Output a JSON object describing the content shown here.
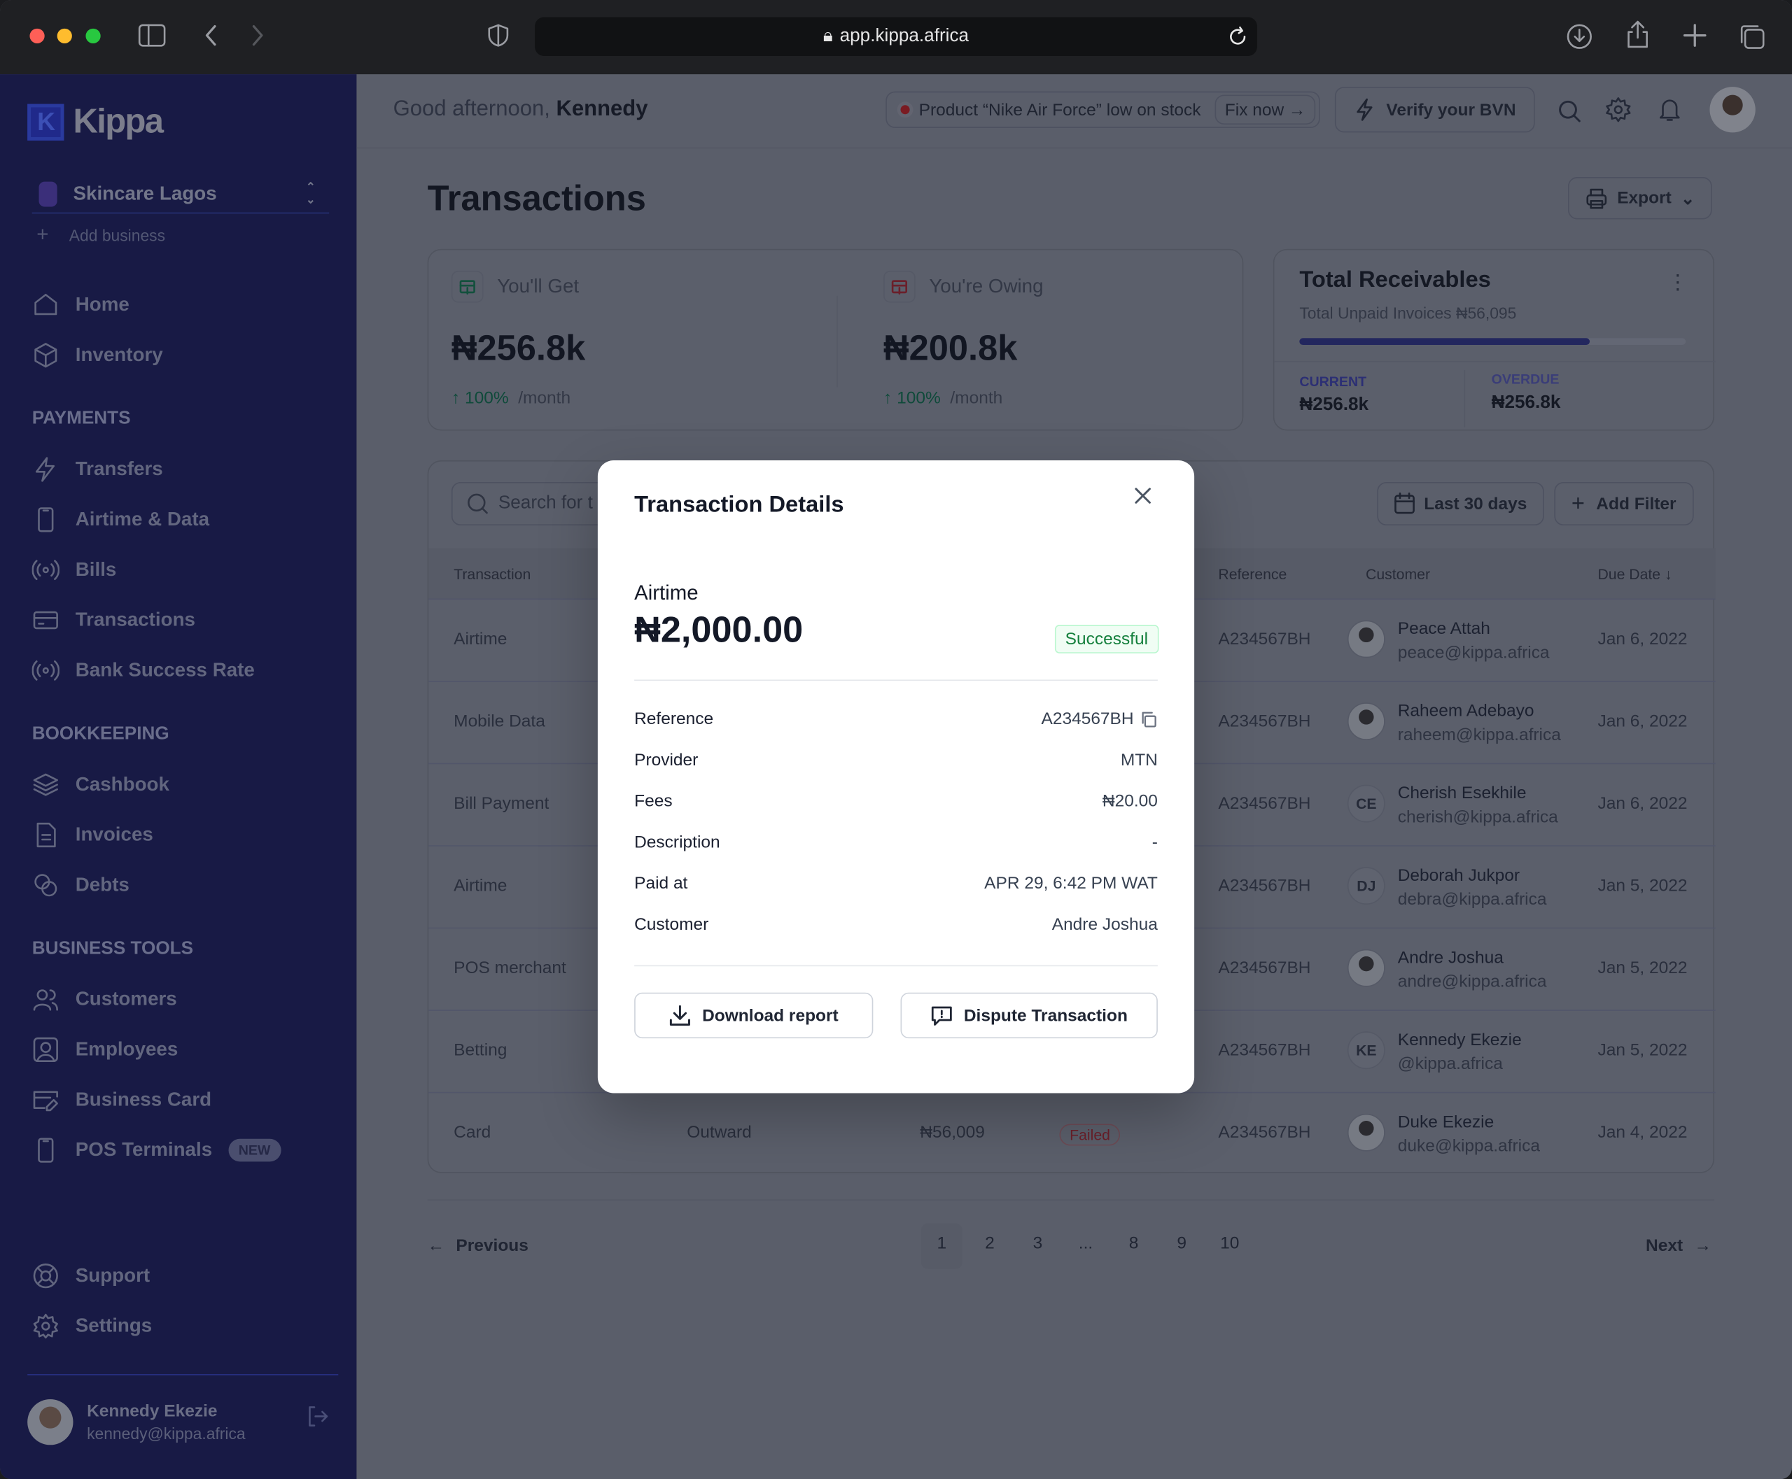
{
  "browser": {
    "url": "app.kippa.africa"
  },
  "sidebar": {
    "logo": "Kippa",
    "business": "Skincare Lagos",
    "add_business": "Add business",
    "top": [
      {
        "label": "Home",
        "icon": "home"
      },
      {
        "label": "Inventory",
        "icon": "box"
      }
    ],
    "sections": [
      {
        "title": "PAYMENTS",
        "items": [
          {
            "label": "Transfers",
            "icon": "bolt"
          },
          {
            "label": "Airtime & Data",
            "icon": "phone"
          },
          {
            "label": "Bills",
            "icon": "broadcast"
          },
          {
            "label": "Transactions",
            "icon": "card"
          },
          {
            "label": "Bank Success Rate",
            "icon": "broadcast"
          }
        ]
      },
      {
        "title": "BOOKKEEPING",
        "items": [
          {
            "label": "Cashbook",
            "icon": "layers"
          },
          {
            "label": "Invoices",
            "icon": "doc"
          },
          {
            "label": "Debts",
            "icon": "coins"
          }
        ]
      },
      {
        "title": "BUSINESS TOOLS",
        "items": [
          {
            "label": "Customers",
            "icon": "users"
          },
          {
            "label": "Employees",
            "icon": "user-square"
          },
          {
            "label": "Business Card",
            "icon": "card-edit"
          },
          {
            "label": "POS Terminals",
            "icon": "phone",
            "badge": "NEW"
          }
        ]
      }
    ],
    "bottom": [
      {
        "label": "Support",
        "icon": "lifebuoy"
      },
      {
        "label": "Settings",
        "icon": "gear"
      }
    ],
    "user": {
      "name": "Kennedy Ekezie",
      "email": "kennedy@kippa.africa"
    }
  },
  "header": {
    "greeting": "Good afternoon,",
    "name": "Kennedy",
    "alert": "Product “Nike Air Force” low on stock",
    "fix": "Fix now",
    "verify": "Verify your BVN"
  },
  "page": {
    "title": "Transactions",
    "export": "Export"
  },
  "stats": {
    "get": {
      "label": "You'll Get",
      "value": "₦256.8k",
      "change": "100%",
      "period": "/month"
    },
    "owing": {
      "label": "You're Owing",
      "value": "₦200.8k",
      "change": "100%",
      "period": "/month"
    },
    "receivables": {
      "title": "Total Receivables",
      "subtitle": "Total Unpaid Invoices ₦56,095",
      "progress_percent": 75,
      "current_label": "CURRENT",
      "current_value": "₦256.8k",
      "overdue_label": "OVERDUE",
      "overdue_value": "₦256.8k"
    }
  },
  "table": {
    "search_placeholder": "Search for t",
    "date_filter": "Last 30 days",
    "add_filter": "Add Filter",
    "headers": {
      "transaction": "Transaction",
      "reference": "Reference",
      "customer": "Customer",
      "due_date": "Due Date"
    },
    "rows": [
      {
        "transaction": "Airtime",
        "reference": "A234567BH",
        "name": "Peace Attah",
        "email": "peace@kippa.africa",
        "initials": "",
        "date": "Jan 6, 2022"
      },
      {
        "transaction": "Mobile Data",
        "reference": "A234567BH",
        "name": "Raheem Adebayo",
        "email": "raheem@kippa.africa",
        "initials": "",
        "date": "Jan 6, 2022"
      },
      {
        "transaction": "Bill Payment",
        "reference": "A234567BH",
        "name": "Cherish Esekhile",
        "email": "cherish@kippa.africa",
        "initials": "CE",
        "date": "Jan 6, 2022"
      },
      {
        "transaction": "Airtime",
        "reference": "A234567BH",
        "name": "Deborah Jukpor",
        "email": "debra@kippa.africa",
        "initials": "DJ",
        "date": "Jan 5, 2022"
      },
      {
        "transaction": "POS merchant",
        "reference": "A234567BH",
        "name": "Andre Joshua",
        "email": "andre@kippa.africa",
        "initials": "",
        "date": "Jan 5, 2022"
      },
      {
        "transaction": "Betting",
        "reference": "A234567BH",
        "name": "Kennedy Ekezie",
        "email": "@kippa.africa",
        "initials": "KE",
        "date": "Jan 5, 2022"
      },
      {
        "transaction": "Card",
        "type": "Outward",
        "amount": "₦56,009",
        "status": "Failed",
        "reference": "A234567BH",
        "name": "Duke Ekezie",
        "email": "duke@kippa.africa",
        "initials": "",
        "date": "Jan 4, 2022"
      }
    ]
  },
  "pagination": {
    "previous": "Previous",
    "next": "Next",
    "pages": [
      "1",
      "2",
      "3",
      "...",
      "8",
      "9",
      "10"
    ],
    "current": "1"
  },
  "modal": {
    "title": "Transaction Details",
    "type": "Airtime",
    "amount": "₦2,000.00",
    "status": "Successful",
    "details": [
      {
        "label": "Reference",
        "value": "A234567BH"
      },
      {
        "label": "Provider",
        "value": "MTN"
      },
      {
        "label": "Fees",
        "value": "₦20.00"
      },
      {
        "label": "Description",
        "value": "-"
      },
      {
        "label": "Paid at",
        "value": "APR 29, 6:42 PM WAT"
      },
      {
        "label": "Customer",
        "value": "Andre Joshua"
      }
    ],
    "download": "Download report",
    "dispute": "Dispute Transaction"
  },
  "colors": {
    "sidebar": "#181a45",
    "accent": "#2b2e7a",
    "success": "#16a34a",
    "danger": "#dc2626"
  }
}
